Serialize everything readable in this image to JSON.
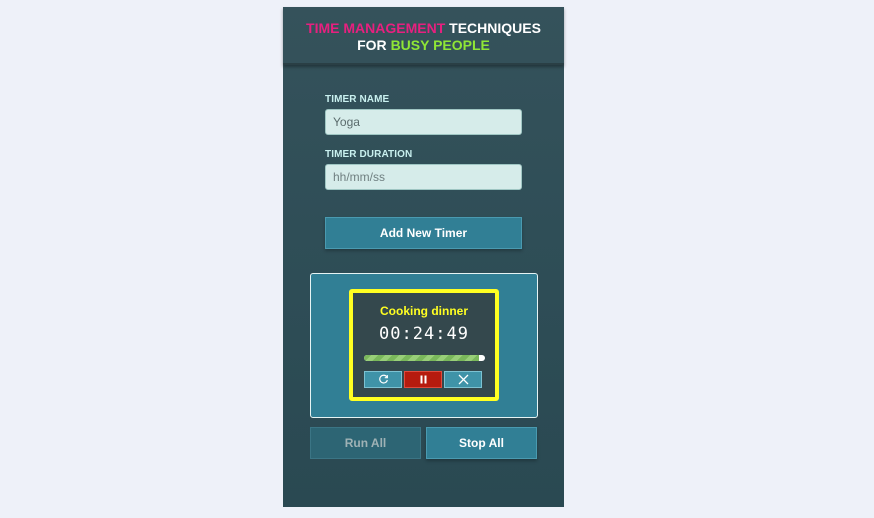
{
  "header": {
    "line1_part1": "TIME MANAGEMENT",
    "line1_part2": " TECHNIQUES",
    "line2_part1": "FOR ",
    "line2_part2": "BUSY PEOPLE"
  },
  "form": {
    "name_label": "TIMER NAME",
    "name_value": "Yoga",
    "duration_label": "TIMER DURATION",
    "duration_placeholder": "hh/mm/ss",
    "add_button": "Add New Timer"
  },
  "timer": {
    "name": "Cooking dinner",
    "time": "00:24:49",
    "progress": 0.95,
    "controls": {
      "reset_icon": "refresh-icon",
      "pause_icon": "pause-icon",
      "close_icon": "close-icon"
    }
  },
  "actions": {
    "run_all": "Run All",
    "stop_all": "Stop All"
  },
  "colors": {
    "accent_pink": "#e7207f",
    "accent_green": "#8fe636",
    "highlight_yellow": "#ffff22",
    "button_teal": "#317f95",
    "pause_red": "#b61b0e"
  }
}
